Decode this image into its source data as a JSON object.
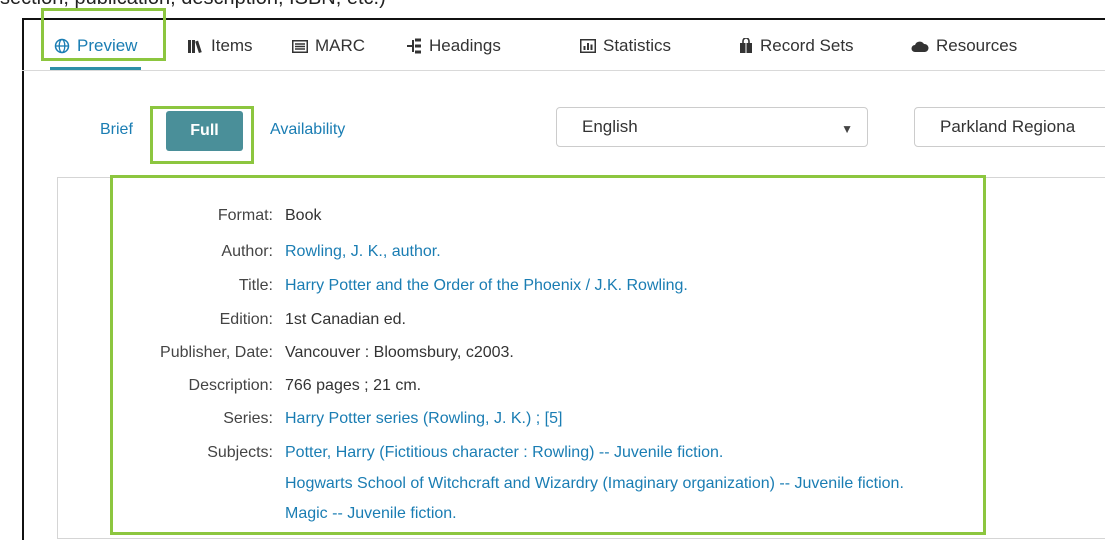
{
  "caption": "section, publication, description, ISBN, etc.)",
  "tabs": [
    {
      "label": "Preview",
      "icon": "globe-icon",
      "active": true
    },
    {
      "label": "Items",
      "icon": "books-icon",
      "active": false
    },
    {
      "label": "MARC",
      "icon": "list-icon",
      "active": false
    },
    {
      "label": "Headings",
      "icon": "tree-icon",
      "active": false
    },
    {
      "label": "Statistics",
      "icon": "bar-chart-icon",
      "active": false
    },
    {
      "label": "Record Sets",
      "icon": "bag-icon",
      "active": false
    },
    {
      "label": "Resources",
      "icon": "cloud-icon",
      "active": false
    }
  ],
  "view_toggle": {
    "brief": "Brief",
    "full": "Full",
    "availability": "Availability"
  },
  "language_select": {
    "value": "English"
  },
  "library_select": {
    "value": "Parkland Regiona"
  },
  "record": {
    "format": {
      "label": "Format:",
      "value": "Book"
    },
    "author": {
      "label": "Author:",
      "value": "Rowling, J. K., author."
    },
    "title": {
      "label": "Title:",
      "value": "Harry Potter and the Order of the Phoenix / J.K. Rowling."
    },
    "edition": {
      "label": "Edition:",
      "value": "1st Canadian ed."
    },
    "publisher": {
      "label": "Publisher, Date:",
      "value": "Vancouver : Bloomsbury, c2003."
    },
    "description": {
      "label": "Description:",
      "value": "766 pages ; 21 cm."
    },
    "series": {
      "label": "Series:",
      "value": "Harry Potter series (Rowling, J. K.) ; [5]"
    },
    "subjects": {
      "label": "Subjects:",
      "values": [
        "Potter, Harry (Fictitious character : Rowling) -- Juvenile fiction.",
        "Hogwarts School of Witchcraft and Wizardry (Imaginary organization) -- Juvenile fiction.",
        "Magic -- Juvenile fiction."
      ]
    }
  },
  "colors": {
    "link": "#1a7db3",
    "accent": "#4a8f99",
    "highlight": "#8cc63f"
  }
}
